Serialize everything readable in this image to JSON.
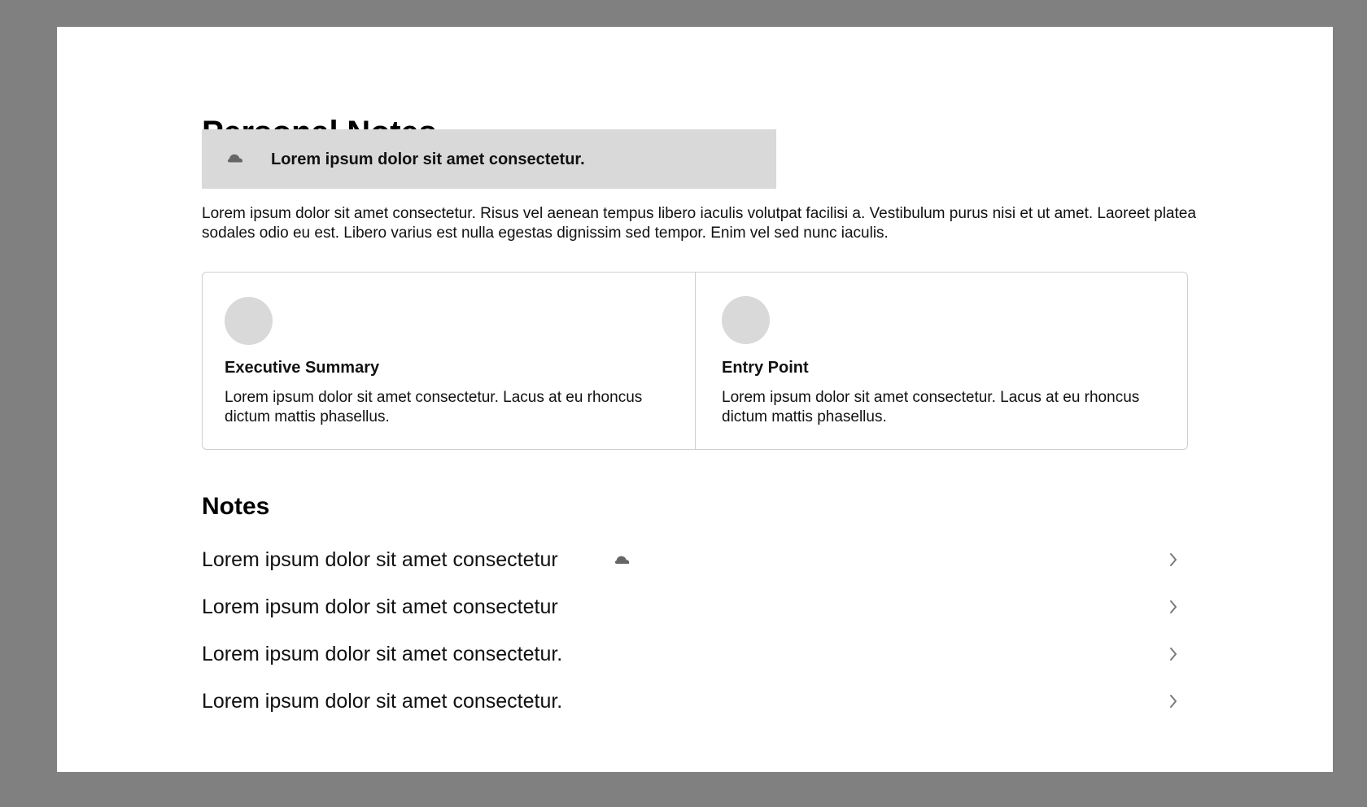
{
  "page": {
    "title": "Personal Notes",
    "background_color": "#808080",
    "canvas_color": "#ffffff",
    "accent_gray": "#d9d9d9"
  },
  "alert": {
    "icon": "cloud-icon",
    "text": "Lorem ipsum dolor sit amet consectetur."
  },
  "intro": {
    "text": "Lorem ipsum dolor sit amet consectetur. Risus vel aenean tempus libero iaculis volutpat facilisi a. Vestibulum purus nisi et ut amet. Laoreet platea sodales odio eu est. Libero varius est nulla egestas dignissim sed tempor. Enim vel sed nunc iaculis."
  },
  "cards": [
    {
      "title": "Executive Summary",
      "description": "Lorem ipsum dolor sit amet consectetur. Lacus at eu rhoncus dictum mattis phasellus."
    },
    {
      "title": "Entry Point",
      "description": "Lorem ipsum dolor sit amet consectetur. Lacus at eu rhoncus dictum mattis phasellus."
    }
  ],
  "notes": {
    "heading": "Notes",
    "items": [
      {
        "text": "Lorem ipsum dolor sit amet consectetur",
        "icon": "cloud-icon",
        "action_icon": "chevron-right-icon"
      },
      {
        "text": "Lorem ipsum dolor sit amet consectetur",
        "action_icon": "chevron-right-icon"
      },
      {
        "text": "Lorem ipsum dolor sit amet consectetur.",
        "action_icon": "chevron-right-icon"
      },
      {
        "text": "Lorem ipsum dolor sit amet consectetur.",
        "action_icon": "chevron-right-icon"
      }
    ]
  }
}
